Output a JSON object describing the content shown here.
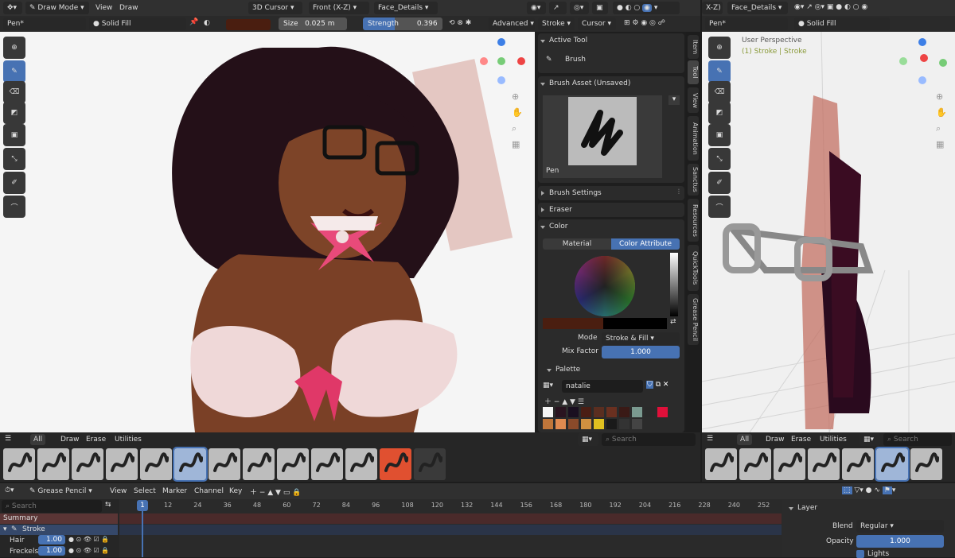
{
  "header_left": {
    "mode": "Draw Mode",
    "menu_view": "View",
    "menu_draw": "Draw",
    "cursor": "3D Cursor",
    "view_axis": "Front (X-Z)",
    "layer": "Face_Details"
  },
  "header_right": {
    "view_axis": "X-Z)",
    "layer": "Face_Details"
  },
  "toolbar": {
    "brush": "Pen*",
    "fill": "Solid Fill",
    "size_label": "Size",
    "size_value": "0.025 m",
    "strength_label": "Strength",
    "strength_value": "0.396",
    "advanced": "Advanced",
    "stroke": "Stroke",
    "cursor": "Cursor"
  },
  "toolbar_right": {
    "brush": "Pen*",
    "fill": "Solid Fill"
  },
  "viewport_right": {
    "perspective": "User Perspective",
    "info": "(1) Stroke | Stroke"
  },
  "sidebar": {
    "active_tool_title": "Active Tool",
    "active_tool": "Brush",
    "brush_asset_title": "Brush Asset (Unsaved)",
    "brush_name": "Pen",
    "brush_settings": "Brush Settings",
    "eraser": "Eraser",
    "color": "Color",
    "tab_material": "Material",
    "tab_color_attribute": "Color Attribute",
    "mode_label": "Mode",
    "mode_value": "Stroke & Fill",
    "mix_label": "Mix Factor",
    "mix_value": "1.000",
    "palette": "Palette",
    "palette_name": "natalie",
    "tabs": [
      "Item",
      "Tool",
      "View",
      "Animation",
      "Sanctus",
      "Resources",
      "QuickTools",
      "Grease Pencil"
    ]
  },
  "asset_bar": {
    "tabs": [
      "All",
      "Draw",
      "Erase",
      "Utilities"
    ],
    "search": "Search"
  },
  "asset_bar_right": {
    "tabs": [
      "All",
      "Draw",
      "Erase",
      "Utilities"
    ],
    "search": "Search"
  },
  "timeline": {
    "editor": "Grease Pencil",
    "menus": [
      "View",
      "Select",
      "Marker",
      "Channel",
      "Key"
    ],
    "search": "Search",
    "frame": "1",
    "ticks": [
      "12",
      "24",
      "36",
      "48",
      "60",
      "72",
      "84",
      "96",
      "108",
      "120",
      "132",
      "144",
      "156",
      "168",
      "180",
      "192",
      "204",
      "216",
      "228",
      "240",
      "252"
    ],
    "channels": [
      {
        "name": "Summary"
      },
      {
        "name": "Stroke"
      },
      {
        "name": "Hair",
        "value": "1.00"
      },
      {
        "name": "Freckels",
        "value": "1.00"
      }
    ]
  },
  "layer_panel": {
    "title": "Layer",
    "blend_label": "Blend",
    "blend_value": "Regular",
    "opacity_label": "Opacity",
    "opacity_value": "1.000",
    "lights": "Lights"
  },
  "colors": {
    "accent": "#4772b3",
    "swatches": [
      "#f5f5f5",
      "#2a1420",
      "#1a0f20",
      "#4a1e14",
      "#5a2e20",
      "#6a3020",
      "#3a1a16",
      "#7a9a90",
      "#2a2a2a",
      "#e0103a",
      "#c0763a",
      "#e08a50",
      "#8a4a2a",
      "#d09040",
      "#e0c020",
      "#1a1a1a",
      "#333",
      "#444"
    ]
  }
}
